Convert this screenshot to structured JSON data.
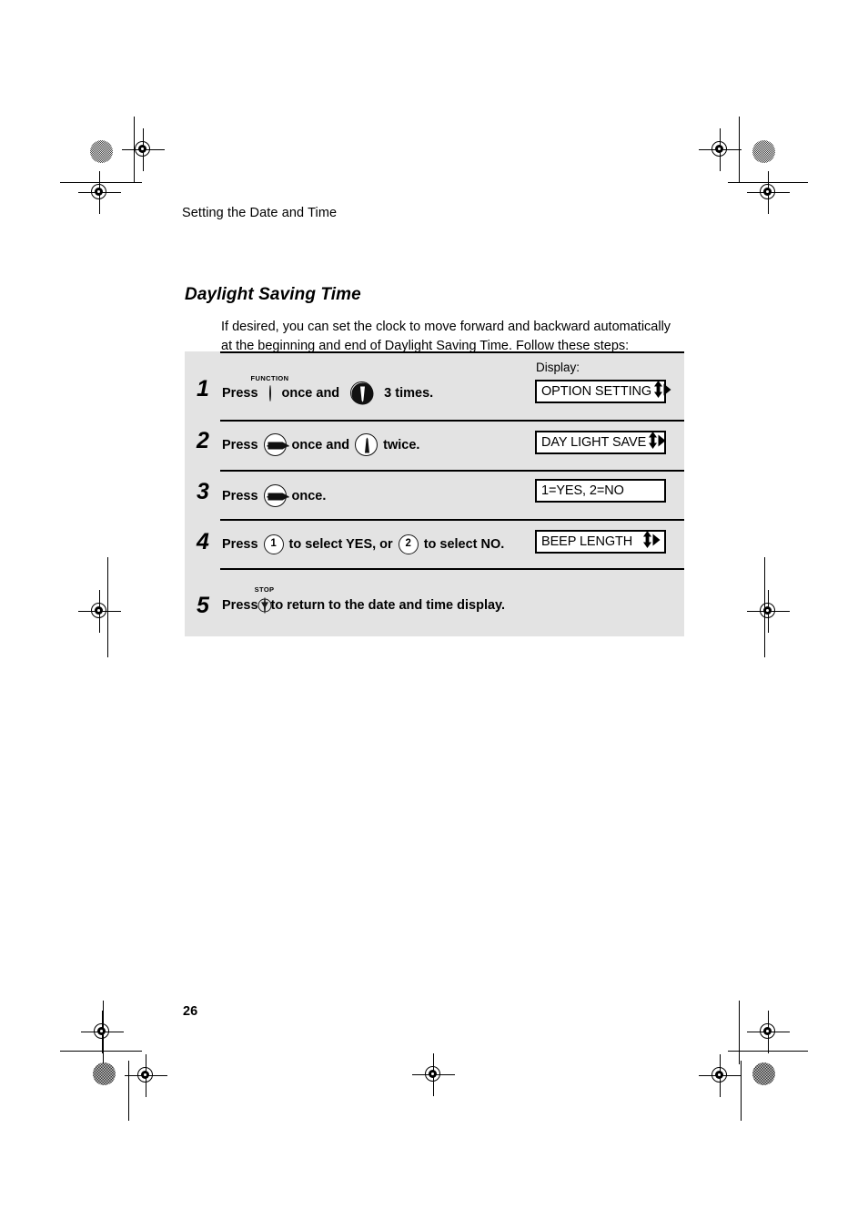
{
  "page": {
    "running_head": "Setting the Date and Time",
    "section_title": "Daylight Saving Time",
    "intro": "If desired, you can set the clock to move forward and backward automatically at the beginning and end of Daylight Saving Time. Follow these steps:",
    "page_number": "26",
    "display_label": "Display:"
  },
  "steps": [
    {
      "number": "1",
      "press_label": "Press",
      "key1_cap": "FUNCTION",
      "key1_icon": "blank-round-key-icon",
      "mid_text": "once and",
      "key2_icon": "down-arrow-key-icon",
      "tail_text": "3 times.",
      "display": {
        "text": "OPTION SETTING",
        "up_down_arrow": "⬍",
        "right_arrow": "▶"
      }
    },
    {
      "number": "2",
      "press_label": "Press",
      "key1_icon": "right-arrow-key-icon",
      "mid_text": "once and",
      "key2_icon": "up-arrow-key-icon",
      "tail_text": "twice.",
      "display": {
        "text": "DAY LIGHT SAVE",
        "up_down_arrow": "⬍",
        "right_arrow": "▶"
      }
    },
    {
      "number": "3",
      "press_label": "Press",
      "key1_icon": "right-arrow-key-icon",
      "tail_text": "once.",
      "display": {
        "text": "1=YES, 2=NO"
      }
    },
    {
      "number": "4",
      "press_label": "Press",
      "key1_icon": "number-key-1-icon",
      "key1_label": "1",
      "mid_text": "to select YES, or",
      "key2_icon": "number-key-2-icon",
      "key2_label": "2",
      "tail_text": "to select NO.",
      "display": {
        "text": "BEEP LENGTH",
        "up_down_arrow": "⬍",
        "right_arrow": "▶"
      }
    },
    {
      "number": "5",
      "press_label": "Press",
      "key1_cap": "STOP",
      "key1_icon": "stop-key-icon",
      "tail_text": "to return to the date and time display."
    }
  ],
  "colors": {
    "panel_background": "#e3e3e3",
    "ink": "#000000",
    "paper": "#ffffff"
  }
}
